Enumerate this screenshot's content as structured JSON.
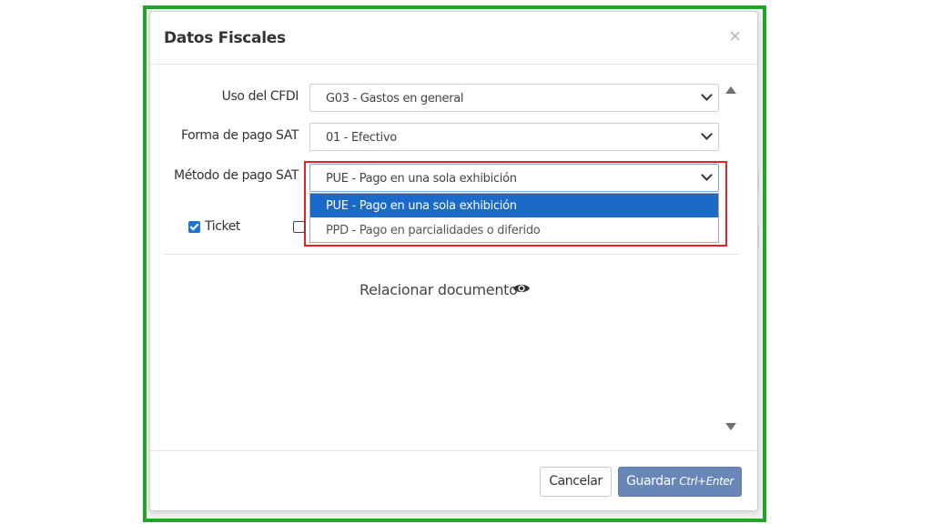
{
  "modal": {
    "title": "Datos Fiscales",
    "close_label": "×"
  },
  "form": {
    "uso_cfdi": {
      "label": "Uso del CFDI",
      "value": "G03 - Gastos en general"
    },
    "forma_pago": {
      "label": "Forma de pago SAT",
      "value": "01 - Efectivo"
    },
    "metodo_pago": {
      "label": "Método de pago SAT",
      "value": "PUE - Pago en una sola exhibición",
      "options": [
        "PUE - Pago en una sola exhibición",
        "PPD - Pago en parcialidades o diferido"
      ]
    },
    "ticket": {
      "label": "Ticket",
      "checked": true
    }
  },
  "relacionar": {
    "label": "Relacionar documento",
    "icon": "eye-icon"
  },
  "footer": {
    "cancel_label": "Cancelar",
    "save_label": "Guardar",
    "save_shortcut": "Ctrl+Enter"
  },
  "colors": {
    "frame_border": "#22a52b",
    "highlight_box": "#e0242a",
    "selected_option": "#1b6ac9",
    "save_button": "#6887b8"
  }
}
